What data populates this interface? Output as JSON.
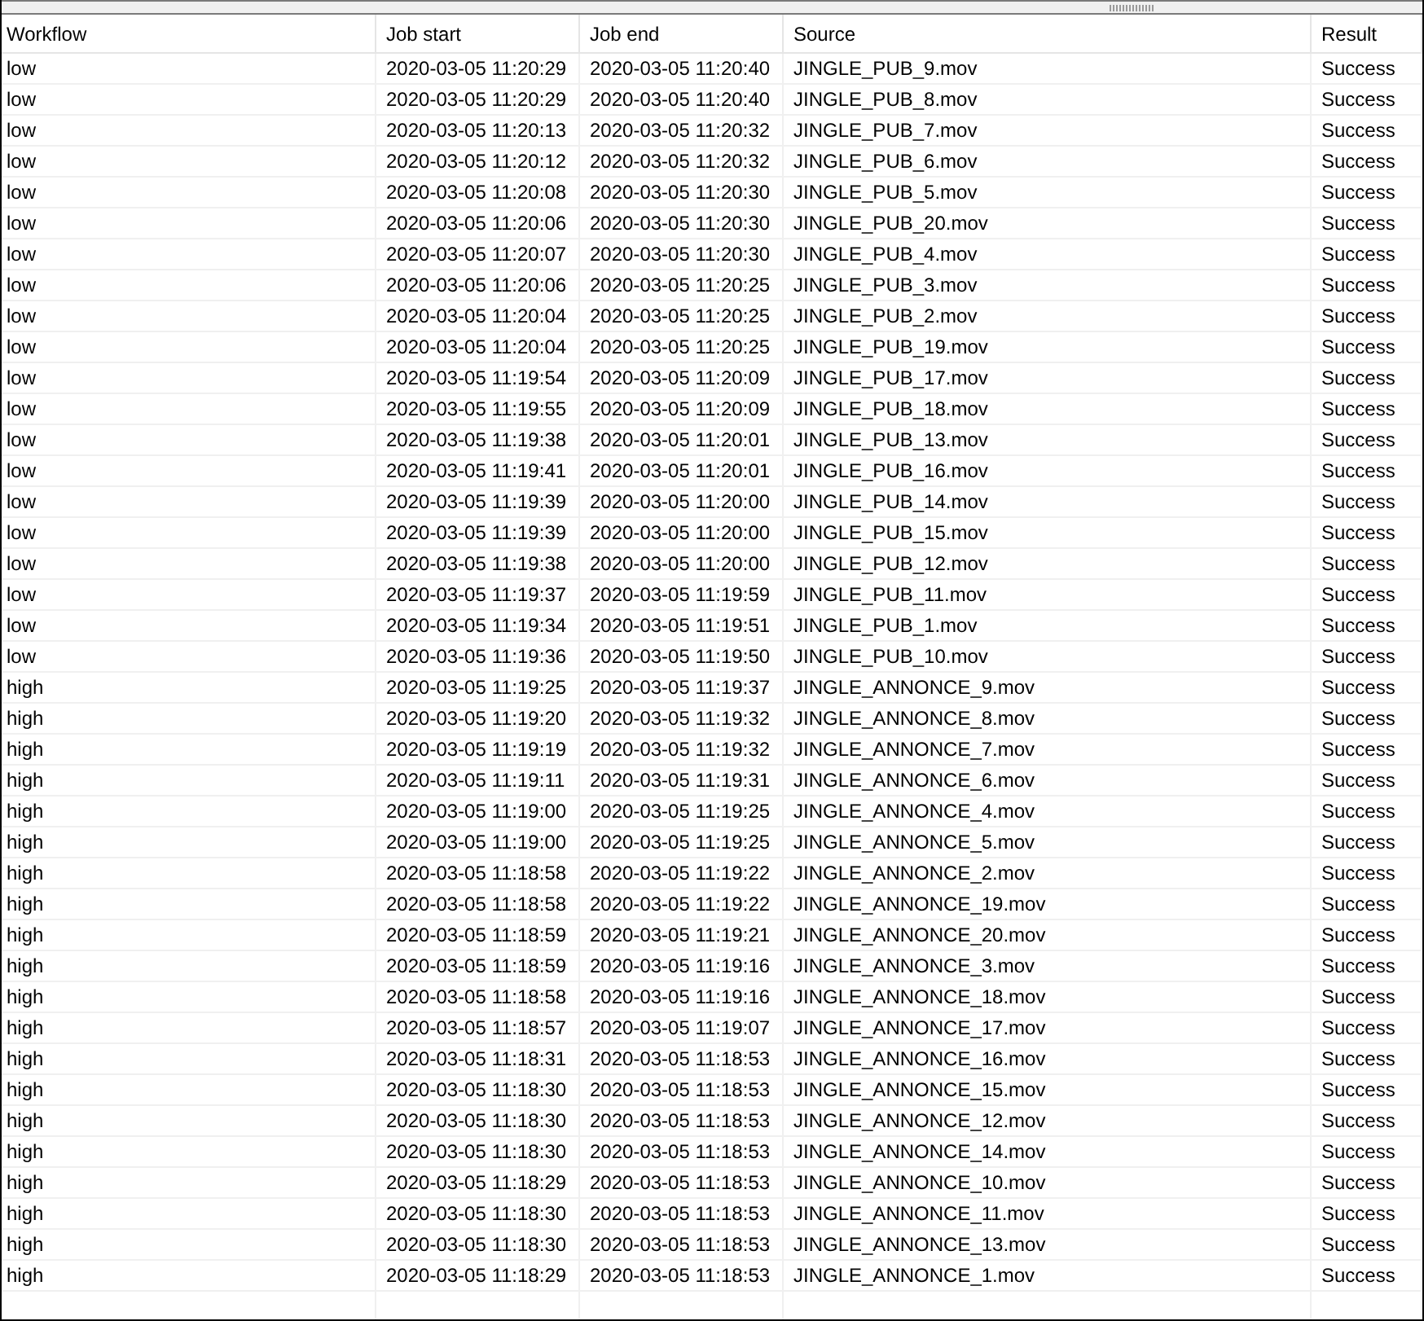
{
  "table": {
    "columns": [
      "Workflow",
      "Job start",
      "Job end",
      "Source",
      "Result"
    ],
    "rows": [
      [
        "low",
        "2020-03-05 11:20:29",
        "2020-03-05 11:20:40",
        "JINGLE_PUB_9.mov",
        "Success"
      ],
      [
        "low",
        "2020-03-05 11:20:29",
        "2020-03-05 11:20:40",
        "JINGLE_PUB_8.mov",
        "Success"
      ],
      [
        "low",
        "2020-03-05 11:20:13",
        "2020-03-05 11:20:32",
        "JINGLE_PUB_7.mov",
        "Success"
      ],
      [
        "low",
        "2020-03-05 11:20:12",
        "2020-03-05 11:20:32",
        "JINGLE_PUB_6.mov",
        "Success"
      ],
      [
        "low",
        "2020-03-05 11:20:08",
        "2020-03-05 11:20:30",
        "JINGLE_PUB_5.mov",
        "Success"
      ],
      [
        "low",
        "2020-03-05 11:20:06",
        "2020-03-05 11:20:30",
        "JINGLE_PUB_20.mov",
        "Success"
      ],
      [
        "low",
        "2020-03-05 11:20:07",
        "2020-03-05 11:20:30",
        "JINGLE_PUB_4.mov",
        "Success"
      ],
      [
        "low",
        "2020-03-05 11:20:06",
        "2020-03-05 11:20:25",
        "JINGLE_PUB_3.mov",
        "Success"
      ],
      [
        "low",
        "2020-03-05 11:20:04",
        "2020-03-05 11:20:25",
        "JINGLE_PUB_2.mov",
        "Success"
      ],
      [
        "low",
        "2020-03-05 11:20:04",
        "2020-03-05 11:20:25",
        "JINGLE_PUB_19.mov",
        "Success"
      ],
      [
        "low",
        "2020-03-05 11:19:54",
        "2020-03-05 11:20:09",
        "JINGLE_PUB_17.mov",
        "Success"
      ],
      [
        "low",
        "2020-03-05 11:19:55",
        "2020-03-05 11:20:09",
        "JINGLE_PUB_18.mov",
        "Success"
      ],
      [
        "low",
        "2020-03-05 11:19:38",
        "2020-03-05 11:20:01",
        "JINGLE_PUB_13.mov",
        "Success"
      ],
      [
        "low",
        "2020-03-05 11:19:41",
        "2020-03-05 11:20:01",
        "JINGLE_PUB_16.mov",
        "Success"
      ],
      [
        "low",
        "2020-03-05 11:19:39",
        "2020-03-05 11:20:00",
        "JINGLE_PUB_14.mov",
        "Success"
      ],
      [
        "low",
        "2020-03-05 11:19:39",
        "2020-03-05 11:20:00",
        "JINGLE_PUB_15.mov",
        "Success"
      ],
      [
        "low",
        "2020-03-05 11:19:38",
        "2020-03-05 11:20:00",
        "JINGLE_PUB_12.mov",
        "Success"
      ],
      [
        "low",
        "2020-03-05 11:19:37",
        "2020-03-05 11:19:59",
        "JINGLE_PUB_11.mov",
        "Success"
      ],
      [
        "low",
        "2020-03-05 11:19:34",
        "2020-03-05 11:19:51",
        "JINGLE_PUB_1.mov",
        "Success"
      ],
      [
        "low",
        "2020-03-05 11:19:36",
        "2020-03-05 11:19:50",
        "JINGLE_PUB_10.mov",
        "Success"
      ],
      [
        "high",
        "2020-03-05 11:19:25",
        "2020-03-05 11:19:37",
        "JINGLE_ANNONCE_9.mov",
        "Success"
      ],
      [
        "high",
        "2020-03-05 11:19:20",
        "2020-03-05 11:19:32",
        "JINGLE_ANNONCE_8.mov",
        "Success"
      ],
      [
        "high",
        "2020-03-05 11:19:19",
        "2020-03-05 11:19:32",
        "JINGLE_ANNONCE_7.mov",
        "Success"
      ],
      [
        "high",
        "2020-03-05 11:19:11",
        "2020-03-05 11:19:31",
        "JINGLE_ANNONCE_6.mov",
        "Success"
      ],
      [
        "high",
        "2020-03-05 11:19:00",
        "2020-03-05 11:19:25",
        "JINGLE_ANNONCE_4.mov",
        "Success"
      ],
      [
        "high",
        "2020-03-05 11:19:00",
        "2020-03-05 11:19:25",
        "JINGLE_ANNONCE_5.mov",
        "Success"
      ],
      [
        "high",
        "2020-03-05 11:18:58",
        "2020-03-05 11:19:22",
        "JINGLE_ANNONCE_2.mov",
        "Success"
      ],
      [
        "high",
        "2020-03-05 11:18:58",
        "2020-03-05 11:19:22",
        "JINGLE_ANNONCE_19.mov",
        "Success"
      ],
      [
        "high",
        "2020-03-05 11:18:59",
        "2020-03-05 11:19:21",
        "JINGLE_ANNONCE_20.mov",
        "Success"
      ],
      [
        "high",
        "2020-03-05 11:18:59",
        "2020-03-05 11:19:16",
        "JINGLE_ANNONCE_3.mov",
        "Success"
      ],
      [
        "high",
        "2020-03-05 11:18:58",
        "2020-03-05 11:19:16",
        "JINGLE_ANNONCE_18.mov",
        "Success"
      ],
      [
        "high",
        "2020-03-05 11:18:57",
        "2020-03-05 11:19:07",
        "JINGLE_ANNONCE_17.mov",
        "Success"
      ],
      [
        "high",
        "2020-03-05 11:18:31",
        "2020-03-05 11:18:53",
        "JINGLE_ANNONCE_16.mov",
        "Success"
      ],
      [
        "high",
        "2020-03-05 11:18:30",
        "2020-03-05 11:18:53",
        "JINGLE_ANNONCE_15.mov",
        "Success"
      ],
      [
        "high",
        "2020-03-05 11:18:30",
        "2020-03-05 11:18:53",
        "JINGLE_ANNONCE_12.mov",
        "Success"
      ],
      [
        "high",
        "2020-03-05 11:18:30",
        "2020-03-05 11:18:53",
        "JINGLE_ANNONCE_14.mov",
        "Success"
      ],
      [
        "high",
        "2020-03-05 11:18:29",
        "2020-03-05 11:18:53",
        "JINGLE_ANNONCE_10.mov",
        "Success"
      ],
      [
        "high",
        "2020-03-05 11:18:30",
        "2020-03-05 11:18:53",
        "JINGLE_ANNONCE_11.mov",
        "Success"
      ],
      [
        "high",
        "2020-03-05 11:18:30",
        "2020-03-05 11:18:53",
        "JINGLE_ANNONCE_13.mov",
        "Success"
      ],
      [
        "high",
        "2020-03-05 11:18:29",
        "2020-03-05 11:18:53",
        "JINGLE_ANNONCE_1.mov",
        "Success"
      ]
    ]
  }
}
